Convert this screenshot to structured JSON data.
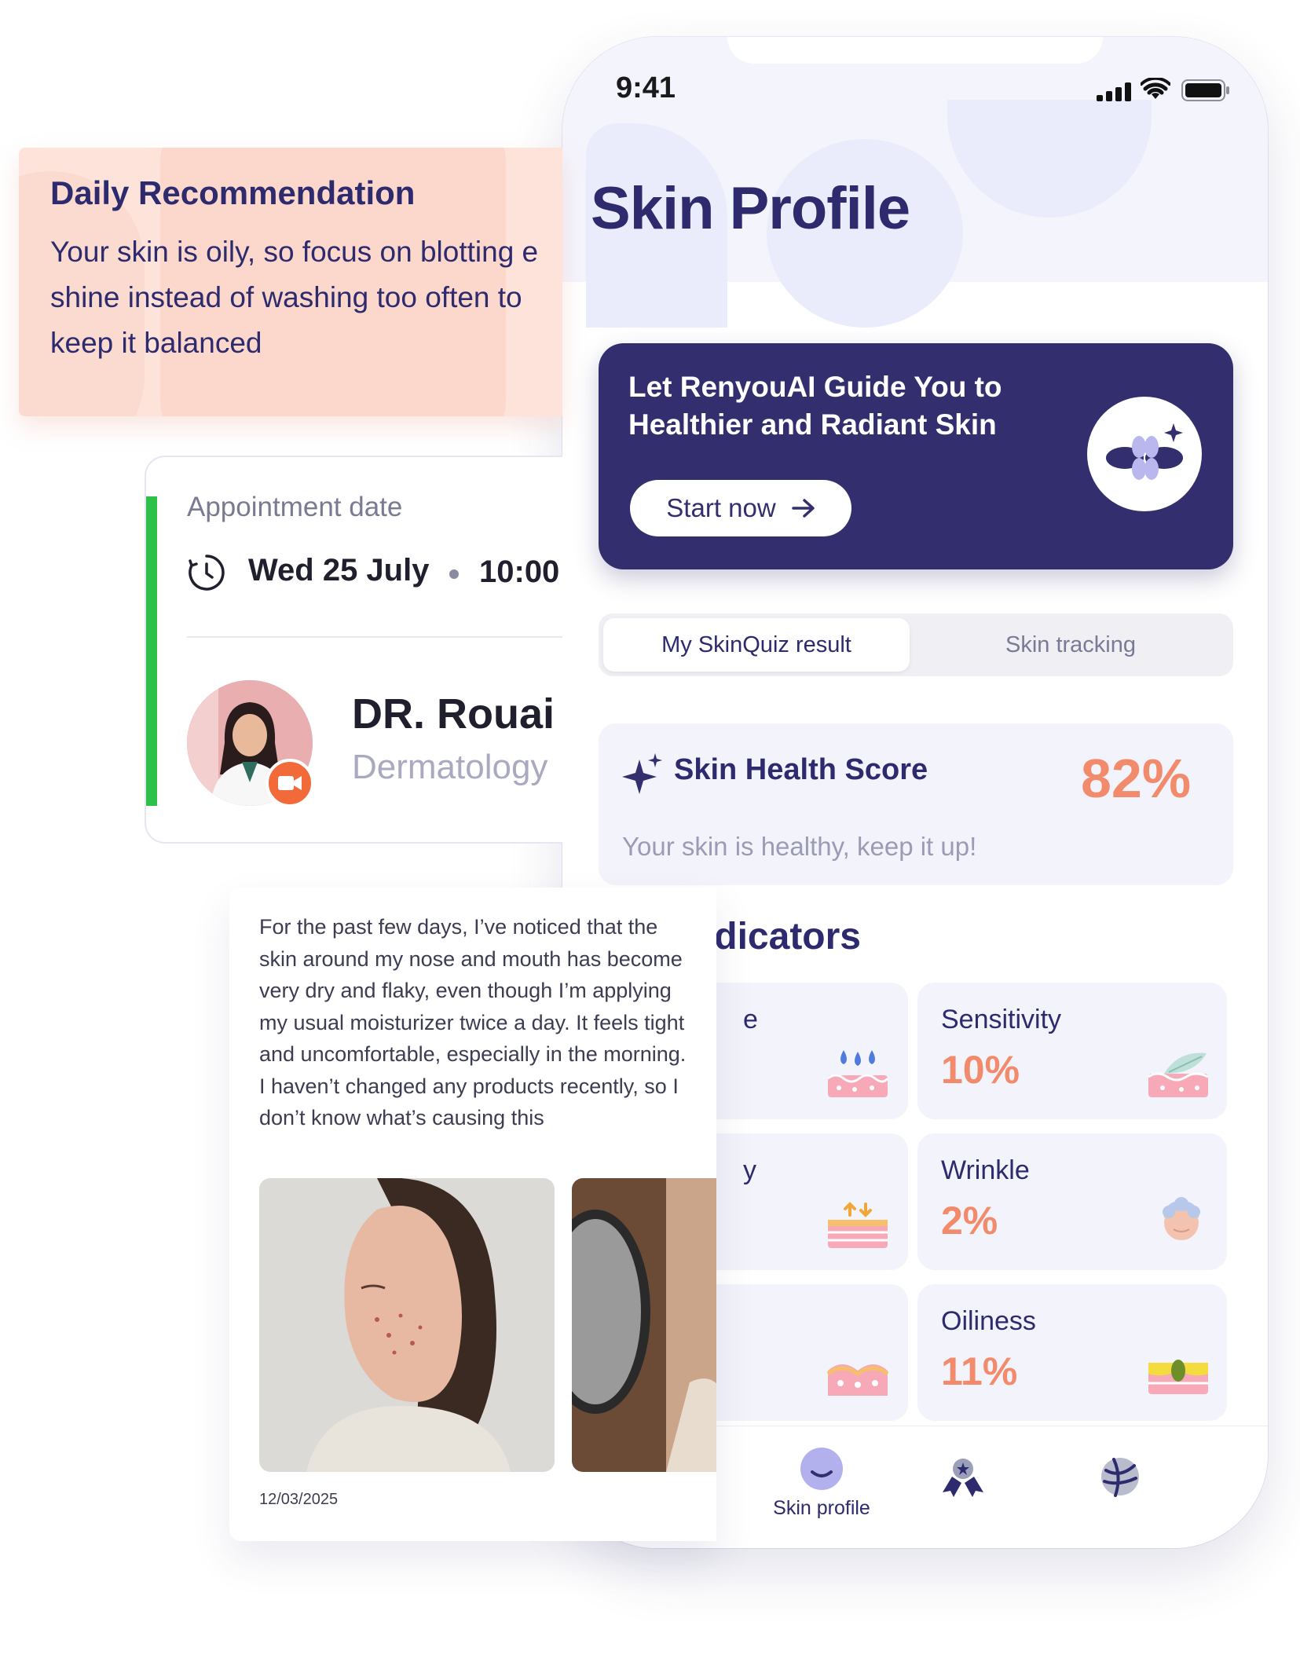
{
  "status_bar": {
    "time": "9:41"
  },
  "phone": {
    "title": "Skin Profile",
    "banner": {
      "text": "Let RenyouAI Guide You to Healthier and Radiant Skin",
      "button_label": "Start now"
    },
    "tabs": [
      {
        "label": "My SkinQuiz result",
        "active": true
      },
      {
        "label": "Skin tracking",
        "active": false
      }
    ],
    "score": {
      "title": "Skin Health Score",
      "value": "82%",
      "description": "Your skin is healthy, keep it up!"
    },
    "indicators": {
      "title_visible": "dicators",
      "left_column_fragments": [
        "e",
        "y",
        ""
      ],
      "items": [
        {
          "label": "Sensitivity",
          "value": "10%",
          "icon": "leaf-skin-icon"
        },
        {
          "label": "Wrinkle",
          "value": "2%",
          "icon": "face-wrinkle-icon"
        },
        {
          "label": "Oiliness",
          "value": "11%",
          "icon": "oil-skin-icon"
        }
      ]
    },
    "bottom_nav": {
      "items": [
        {
          "label": "Skin profile",
          "icon": "skin-profile-icon",
          "active": true
        },
        {
          "label": "",
          "icon": "awards-icon",
          "active": false
        },
        {
          "label": "",
          "icon": "tracking-icon",
          "active": false
        }
      ]
    }
  },
  "daily_recommendation": {
    "title": "Daily Recommendation",
    "lines": [
      "Your skin is oily, so focus on blotting e",
      "shine instead of washing too often to",
      "keep it balanced"
    ]
  },
  "appointment": {
    "label": "Appointment date",
    "date": "Wed 25 July",
    "time": "10:00",
    "doctor_name": "DR. Rouai I",
    "specialty": "Dermatology"
  },
  "note": {
    "text": "For the past few days, I’ve noticed that the skin around my nose and mouth has become very dry and flaky, even though I’m applying my usual moisturizer twice a day. It feels tight and uncomfortable, especially in the morning. I haven’t changed any products recently, so I don’t know what’s causing this",
    "date": "12/03/2025"
  },
  "colors": {
    "primary": "#332e6e",
    "accent": "#f28b6b",
    "recommendation_bg": "#fde3d9",
    "appointment_bar": "#2ec14a",
    "video_badge": "#f26a3a"
  }
}
